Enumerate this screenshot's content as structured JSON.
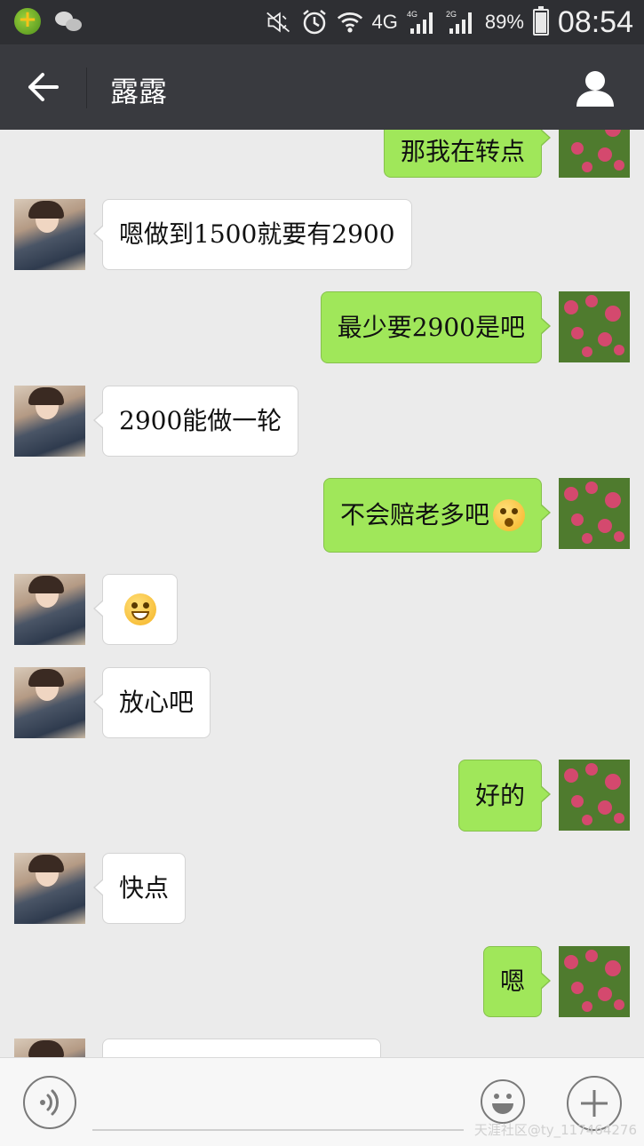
{
  "status_bar": {
    "battery": "89%",
    "time": "08:54",
    "network_1": "4G",
    "network_2_small": "4G",
    "network_3_small": "2G"
  },
  "header": {
    "title": "露露"
  },
  "messages": [
    {
      "side": "right",
      "text": "那我在转点"
    },
    {
      "side": "left",
      "text": "嗯做到1500就要有2900"
    },
    {
      "side": "right",
      "text": "最少要2900是吧"
    },
    {
      "side": "left",
      "text": "2900能做一轮"
    },
    {
      "side": "right",
      "text": "不会赔老多吧",
      "emoji": "shocked-face"
    },
    {
      "side": "left",
      "text": "",
      "emoji": "grinning-face"
    },
    {
      "side": "left",
      "text": "放心吧"
    },
    {
      "side": "right",
      "text": "好的"
    },
    {
      "side": "left",
      "text": "快点"
    },
    {
      "side": "right",
      "text": "嗯"
    },
    {
      "side": "left",
      "text": ""
    }
  ],
  "watermark": "天涯社区@ty_117464276"
}
